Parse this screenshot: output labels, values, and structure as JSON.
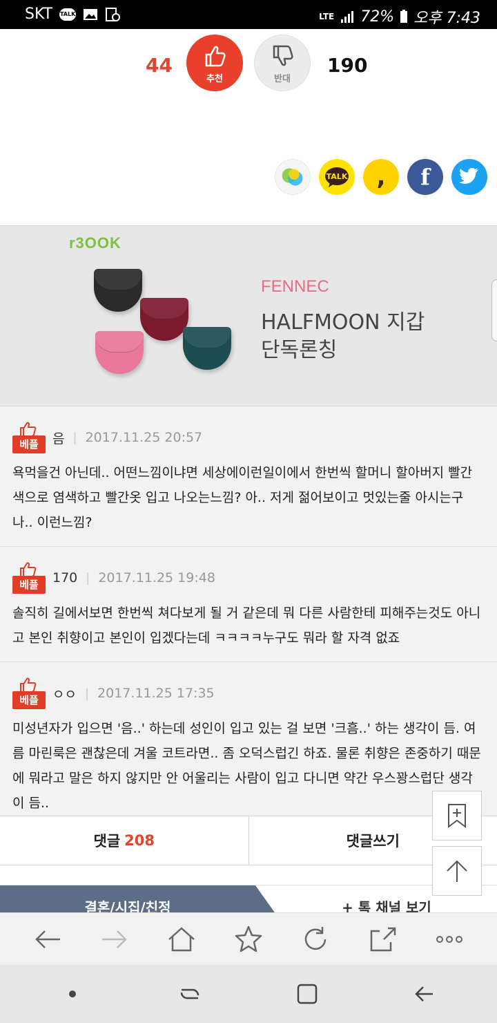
{
  "status_bar": {
    "carrier": "SKT",
    "talk_icon_text": "TALK",
    "network": "LTE",
    "battery": "72%",
    "time": "오후 7:43"
  },
  "vote": {
    "up_count": "44",
    "up_label": "추천",
    "down_label": "반대",
    "down_count": "190"
  },
  "share": {
    "kakaotalk_label": "TALK",
    "kakaostory_symbol": ",",
    "facebook_symbol": "f"
  },
  "ad": {
    "logo": "r3OOK",
    "brand": "FENNEC",
    "line1": "HALFMOON 지갑",
    "line2": "단독론칭"
  },
  "comments": [
    {
      "badge": "베플",
      "author": "음",
      "date": "2017.11.25 20:57",
      "body": "욕먹을건 아닌데.. 어떤느낌이냐면 세상에이런일이에서 한번씩 할머니 할아버지 빨간색으로 염색하고 빨간옷 입고 나오는느낌? 아.. 저게 젊어보이고 멋있는줄 아시는구나.. 이런느낌?"
    },
    {
      "badge": "베플",
      "author": "170",
      "date": "2017.11.25 19:48",
      "body": "솔직히 길에서보면 한번씩 쳐다보게 될 거 같은데 뭐 다른 사람한테 피해주는것도 아니고 본인 취향이고 본인이 입겠다는데 ㅋㅋㅋㅋ누구도 뭐라 할 자격 없죠"
    },
    {
      "badge": "베플",
      "author": "ㅇㅇ",
      "date": "2017.11.25 17:35",
      "body": "미성년자가 입으면 '음..' 하는데 성인이 입고 있는 걸 보면 '크흠..' 하는 생각이 듬. 여름 마린룩은 괜찮은데 겨울 코트라면.. 좀 오덕스럽긴 하죠. 물론 취향은 존중하기 때문에 뭐라고 말은 하지 않지만 안 어울리는 사람이 입고 다니면 약간 우스꽝스럽단 생각이 듬.."
    }
  ],
  "comment_bar": {
    "comments_label": "댓글",
    "comments_count": "208",
    "write_label": "댓글쓰기"
  },
  "tabs": {
    "active": "결혼/시집/친정",
    "other": "+ 톡 채널 보기"
  }
}
